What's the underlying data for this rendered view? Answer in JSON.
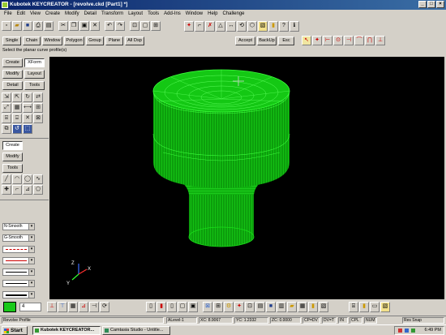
{
  "window": {
    "title": "Kubotek KEYCREATOR - [revolve.ckd [Part1] *]",
    "controls": [
      "_",
      "□",
      "×"
    ]
  },
  "menu": [
    "File",
    "Edit",
    "View",
    "Create",
    "Modify",
    "Detail",
    "Transform",
    "Layout",
    "Tools",
    "Add-Ins",
    "Window",
    "Help",
    "Challenge"
  ],
  "command_buttons": {
    "single": "Single",
    "chain": "Chain",
    "window": "Window",
    "polygon": "Polygon",
    "group": "Group",
    "plane": "Plane",
    "all_dsp": "All Dsp",
    "accept": "Accept",
    "backup": "BackUp",
    "esc": "Esc"
  },
  "prompt": "Select the planar curve profile(s)",
  "left_panel": {
    "tabs_top": [
      {
        "label": "Create",
        "active": false
      },
      {
        "label": "XForm",
        "active": true
      },
      {
        "label": "Modify",
        "active": false
      },
      {
        "label": "Layout",
        "active": false
      },
      {
        "label": "Detail",
        "active": false
      },
      {
        "label": "Tools",
        "active": false
      }
    ],
    "tabs_bottom": [
      {
        "label": "Create",
        "active": true
      },
      {
        "label": "Modify",
        "active": false
      },
      {
        "label": "Tools",
        "active": false
      }
    ],
    "dropdowns": [
      {
        "label": "N-Smooth"
      },
      {
        "label": "G-Smooth"
      },
      {
        "label": "",
        "line_color": "#cc0000",
        "line_style": "dash-dot"
      },
      {
        "label": "",
        "line_color": "#cc0000",
        "line_style": "solid"
      },
      {
        "label": "",
        "line_color": "#000000",
        "line_style": "solid-thin"
      },
      {
        "label": "",
        "line_color": "#000000",
        "line_style": "solid"
      },
      {
        "label": "",
        "line_color": "#000000",
        "line_style": "solid"
      }
    ]
  },
  "viewport": {
    "background": "#000000",
    "model_color": "#19d919",
    "axis_labels": {
      "x": "X",
      "y": "Y",
      "z": "Z"
    }
  },
  "bottom_toolbar": {
    "current_color": "#19c919",
    "layer": "4"
  },
  "status": {
    "left": "Revolve Profile",
    "level": "ALevel-1",
    "xc": "XC: 8.9067",
    "yc": "YC: 1.2332",
    "zc": "ZC: 0.0000",
    "cp": "CP=DV",
    "dv": "DV=T",
    "in": "IN",
    "cpl": "CPL",
    "num": "NUM",
    "snap": "Res Snap"
  },
  "taskbar": {
    "start": "Start",
    "items": [
      {
        "label": "Kubotek KEYCREATOR...",
        "active": true
      },
      {
        "label": "Camtasia Studio - Untitle...",
        "active": false
      }
    ],
    "clock": "6:49 PM"
  }
}
